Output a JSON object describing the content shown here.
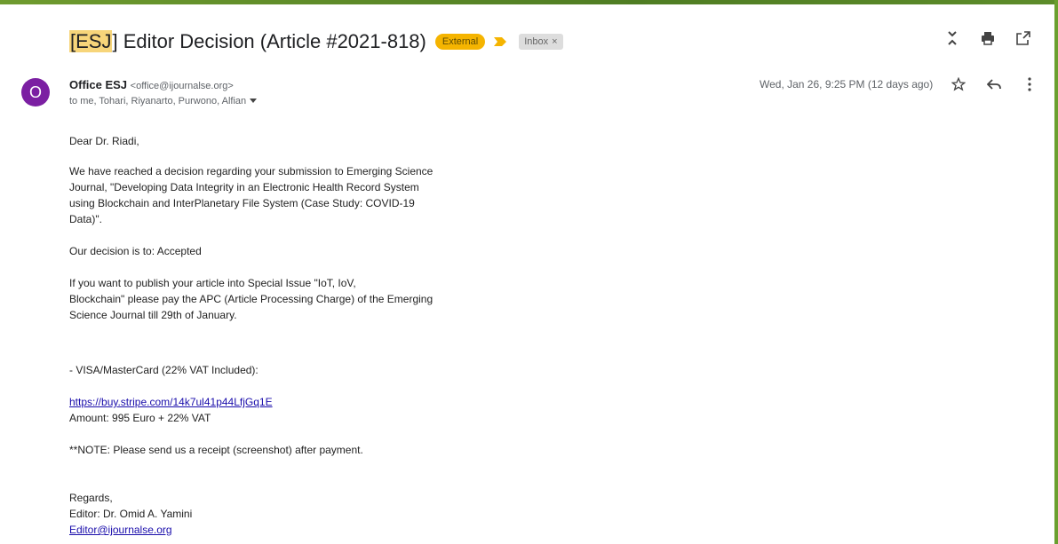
{
  "subject": {
    "prefix": "ESJ",
    "text": "] Editor Decision (Article #2021-818)",
    "open_bracket": "["
  },
  "labels": {
    "external": "External",
    "inbox": "Inbox",
    "inbox_remove": "×"
  },
  "sender": {
    "name": "Office ESJ",
    "email": "<office@ijournalse.org>",
    "avatar_letter": "O",
    "avatar_color": "#7b1fa2"
  },
  "recipients": "to me, Tohari, Riyanarto, Purwono, Alfian",
  "date": "Wed, Jan 26, 9:25 PM (12 days ago)",
  "body": {
    "greeting": "Dear Dr. Riadi,",
    "p1_l1": "We have reached a decision regarding your submission to Emerging Science",
    "p1_l2": "Journal, \"Developing Data Integrity in an Electronic Health Record System",
    "p1_l3": "using Blockchain and InterPlanetary File System  (Case Study: COVID-19",
    "p1_l4": "Data)\".",
    "decision": "Our decision is to: Accepted",
    "p2_l1": "If you want to publish your article into Special Issue \"IoT, IoV,",
    "p2_l2": "Blockchain\" please pay the APC (Article Processing Charge) of the Emerging",
    "p2_l3": "Science Journal till 29th of January.",
    "visa": "- VISA/MasterCard (22% VAT Included):",
    "payment_link": "https://buy.stripe.com/14k7ul41p44LfjGq1E",
    "amount": "Amount: 995 Euro + 22% VAT",
    "note": "**NOTE: Please send us a receipt (screenshot) after payment.",
    "regards": "Regards,",
    "editor": "Editor: Dr. Omid A. Yamini",
    "editor_email": "Editor@ijournalse.org"
  },
  "colors": {
    "external_label": "#f5b400",
    "importance_marker": "#f5b400",
    "link": "#1a0dab"
  }
}
